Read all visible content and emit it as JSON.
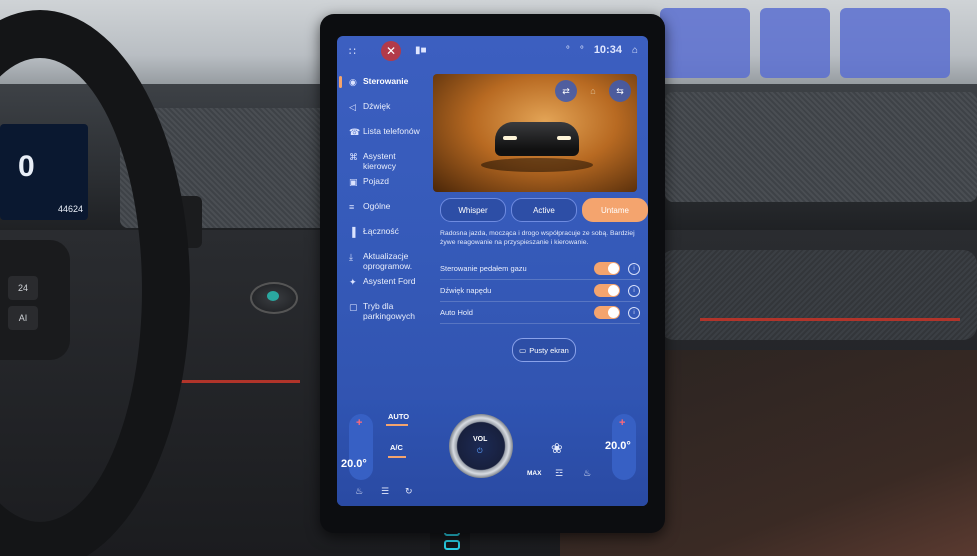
{
  "status_bar": {
    "apps_icon": "grid-icon",
    "close_icon": "close-icon",
    "media_icon": "media-icon",
    "time": "10:34",
    "signal_text": "°",
    "bluetooth_text": "°",
    "profile_icon": "profile-icon"
  },
  "menu": {
    "items": [
      {
        "label": "Sterowanie",
        "icon": "car-icon"
      },
      {
        "label": "Dźwięk",
        "icon": "speaker-icon"
      },
      {
        "label": "Lista telefonów",
        "icon": "phone-icon"
      },
      {
        "label": "Asystent kierowcy",
        "icon": "assist-icon"
      },
      {
        "label": "Pojazd",
        "icon": "vehicle-icon"
      },
      {
        "label": "Ogólne",
        "icon": "general-icon"
      },
      {
        "label": "Łączność",
        "icon": "signal-icon"
      },
      {
        "label": "Aktualizacje oprogramow.",
        "icon": "download-icon"
      },
      {
        "label": "Asystent Ford",
        "icon": "mic-icon"
      },
      {
        "label": "Tryb dla parkingowych",
        "icon": "valet-icon"
      }
    ]
  },
  "modes": {
    "whisper": "Whisper",
    "active": "Active",
    "third": "Untame",
    "selected": "third"
  },
  "description": "Radosna jazda, mocząca i drogo współpracuje ze sobą. Bardziej żywe reagowanie na przyspieszanie i kierowanie.",
  "settings": [
    {
      "label": "Sterowanie pedałem gazu",
      "on": true
    },
    {
      "label": "Dźwięk napędu",
      "on": true
    },
    {
      "label": "Auto Hold",
      "on": true
    }
  ],
  "clean_button": "Pusty ekran",
  "climate": {
    "left_temp": "20.0°",
    "right_temp": "20.0°",
    "auto_label": "AUTO",
    "ac_label": "A/C",
    "knob_label": "VOL",
    "max_label": "MAX",
    "fan_icon": "fan-icon"
  },
  "cluster": {
    "speed": "0",
    "odometer": "44624"
  },
  "wheel_buttons": [
    "24",
    "AI"
  ]
}
